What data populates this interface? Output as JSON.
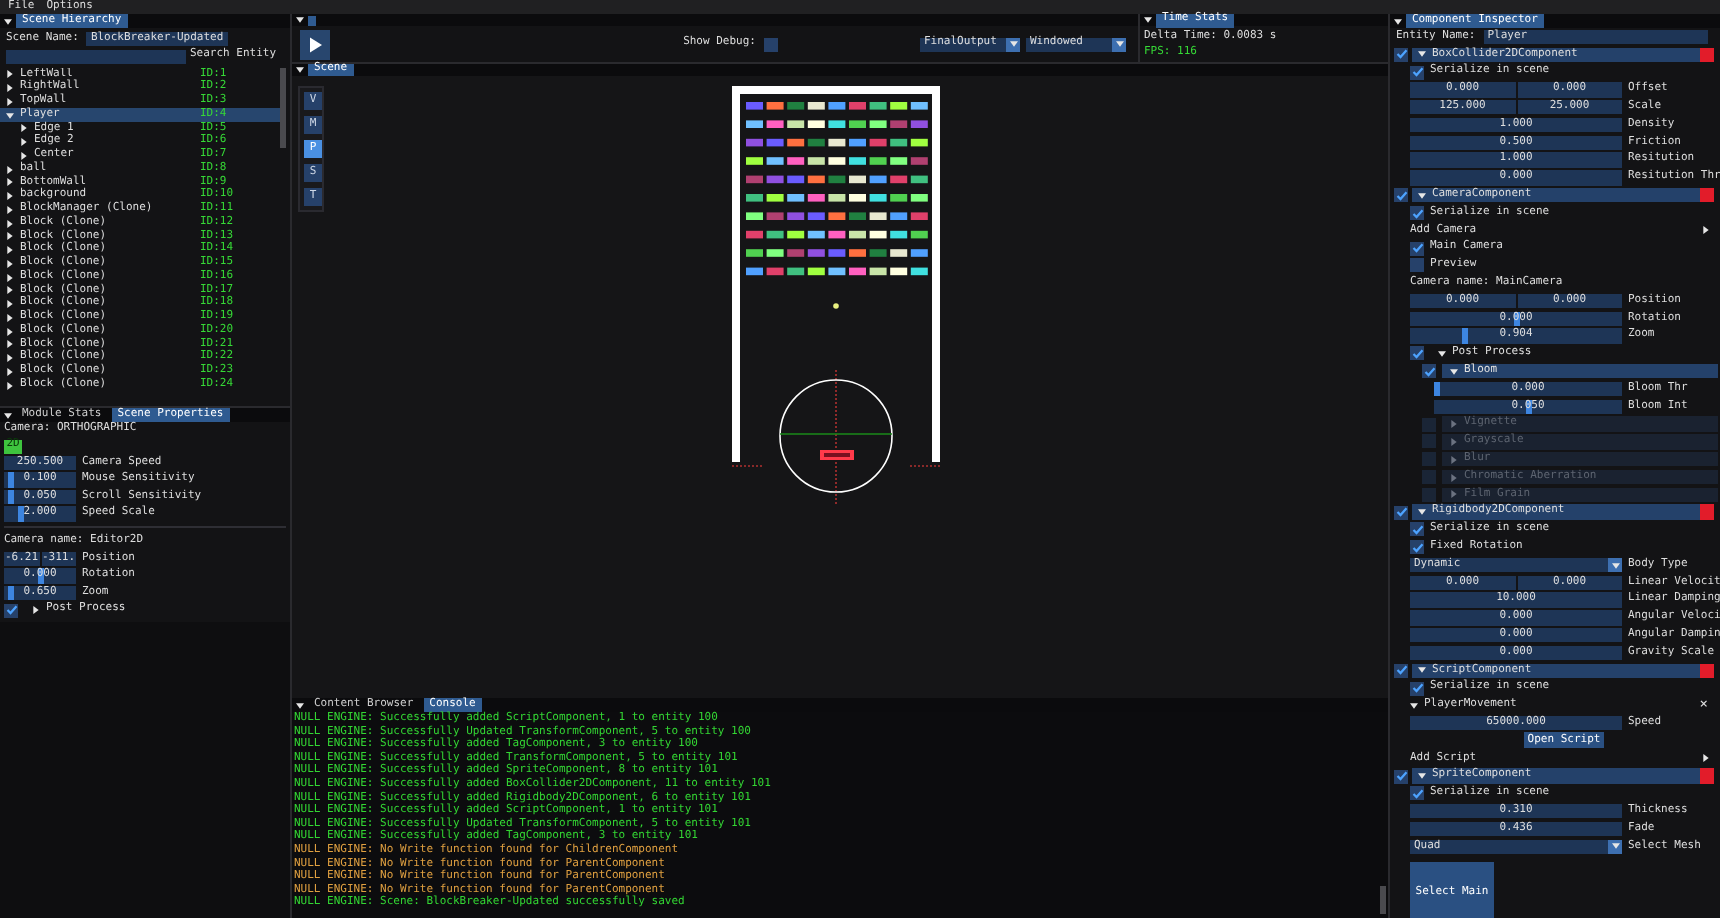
{
  "menu": [
    {
      "label": "File"
    },
    {
      "label": "Options"
    }
  ],
  "hierarchy": {
    "tab": "Scene Hierarchy",
    "scene_name_label": "Scene Name:",
    "scene_name": "BlockBreaker-Updated",
    "search_button": "Search Entity",
    "entities": [
      {
        "name": "LeftWall",
        "id": "ID:1",
        "selected": false,
        "expanded": false
      },
      {
        "name": "RightWall",
        "id": "ID:2",
        "selected": false,
        "expanded": false
      },
      {
        "name": "TopWall",
        "id": "ID:3",
        "selected": false,
        "expanded": false
      },
      {
        "name": "Player",
        "id": "ID:4",
        "selected": true,
        "expanded": true,
        "children": [
          {
            "name": "Edge 1",
            "id": "ID:5",
            "selected": false,
            "expanded": false
          },
          {
            "name": "Edge 2",
            "id": "ID:6",
            "selected": false,
            "expanded": false
          },
          {
            "name": "Center",
            "id": "ID:7",
            "selected": false,
            "expanded": false
          }
        ]
      },
      {
        "name": "ball",
        "id": "ID:8",
        "selected": false,
        "expanded": false
      },
      {
        "name": "BottomWall",
        "id": "ID:9",
        "selected": false,
        "expanded": false
      },
      {
        "name": "background",
        "id": "ID:10",
        "selected": false,
        "expanded": false
      },
      {
        "name": "BlockManager (Clone)",
        "id": "ID:11",
        "selected": false,
        "expanded": false
      },
      {
        "name": "Block (Clone)",
        "id": "ID:12",
        "selected": false,
        "expanded": false
      },
      {
        "name": "Block (Clone)",
        "id": "ID:13",
        "selected": false,
        "expanded": false
      },
      {
        "name": "Block (Clone)",
        "id": "ID:14",
        "selected": false,
        "expanded": false
      },
      {
        "name": "Block (Clone)",
        "id": "ID:15",
        "selected": false,
        "expanded": false
      },
      {
        "name": "Block (Clone)",
        "id": "ID:16",
        "selected": false,
        "expanded": false
      },
      {
        "name": "Block (Clone)",
        "id": "ID:17",
        "selected": false,
        "expanded": false
      },
      {
        "name": "Block (Clone)",
        "id": "ID:18",
        "selected": false,
        "expanded": false
      },
      {
        "name": "Block (Clone)",
        "id": "ID:19",
        "selected": false,
        "expanded": false
      },
      {
        "name": "Block (Clone)",
        "id": "ID:20",
        "selected": false,
        "expanded": false
      },
      {
        "name": "Block (Clone)",
        "id": "ID:21",
        "selected": false,
        "expanded": false
      },
      {
        "name": "Block (Clone)",
        "id": "ID:22",
        "selected": false,
        "expanded": false
      },
      {
        "name": "Block (Clone)",
        "id": "ID:23",
        "selected": false,
        "expanded": false
      },
      {
        "name": "Block (Clone)",
        "id": "ID:24",
        "selected": false,
        "expanded": false
      }
    ]
  },
  "properties": {
    "tabs": [
      {
        "label": "Module Stats",
        "selected": false
      },
      {
        "label": "Scene Properties",
        "selected": true
      }
    ],
    "camera_type": "Camera: ORTHOGRAPHIC",
    "mode_button": "2D",
    "rows": [
      {
        "kind": "fields",
        "values": [
          "250.500"
        ],
        "label": "Camera Speed"
      },
      {
        "kind": "slider",
        "value": "0.100",
        "level": 0.05,
        "label": "Mouse Sensitivity"
      },
      {
        "kind": "slider",
        "value": "0.050",
        "level": 0.05,
        "label": "Scroll Sensitivity"
      },
      {
        "kind": "slider",
        "value": "2.000",
        "level": 0.2,
        "label": "Speed Scale"
      }
    ],
    "camera_rows": [
      {
        "kind": "text",
        "text": "Camera name: Editor2D"
      },
      {
        "kind": "fields",
        "values": [
          "-6.21",
          "-311."
        ],
        "label": "Position"
      },
      {
        "kind": "slider",
        "value": "0.000",
        "level": 0.5,
        "label": "Rotation"
      },
      {
        "kind": "slider",
        "value": "0.650",
        "level": 0.05,
        "label": "Zoom"
      },
      {
        "kind": "node",
        "checked": true,
        "title": "Post Process",
        "expanded": false,
        "framed": false,
        "disabled": false
      }
    ]
  },
  "toolbar": {
    "show_debug_label": "Show Debug:",
    "show_debug": false,
    "dropdowns": [
      {
        "value": "FinalOutput"
      },
      {
        "value": "Windowed"
      }
    ]
  },
  "time_stats": {
    "tab": "Time Stats",
    "delta": "Delta Time: 0.0083 s",
    "fps": "FPS: 116"
  },
  "scene": {
    "tab": "Scene",
    "gizmos": [
      {
        "label": "V",
        "selected": false
      },
      {
        "label": "M",
        "selected": false
      },
      {
        "label": "P",
        "selected": true
      },
      {
        "label": "S",
        "selected": false
      },
      {
        "label": "T",
        "selected": false
      }
    ]
  },
  "console": {
    "tabs": [
      {
        "label": "Content Browser",
        "selected": false
      },
      {
        "label": "Console",
        "selected": true
      }
    ],
    "lines": [
      {
        "text": "NULL ENGINE: Successfully added ScriptComponent, 1 to entity 100",
        "color": "#33d633"
      },
      {
        "text": "NULL ENGINE: Successfully Updated TransformComponent, 5 to entity 100",
        "color": "#33d633"
      },
      {
        "text": "NULL ENGINE: Successfully added TagComponent, 3 to entity 100",
        "color": "#33d633"
      },
      {
        "text": "NULL ENGINE: Successfully added TransformComponent, 5 to entity 101",
        "color": "#33d633"
      },
      {
        "text": "NULL ENGINE: Successfully added SpriteComponent, 8 to entity 101",
        "color": "#33d633"
      },
      {
        "text": "NULL ENGINE: Successfully added BoxCollider2DComponent, 11 to entity 101",
        "color": "#33d633"
      },
      {
        "text": "NULL ENGINE: Successfully added Rigidbody2DComponent, 6 to entity 101",
        "color": "#33d633"
      },
      {
        "text": "NULL ENGINE: Successfully added ScriptComponent, 1 to entity 101",
        "color": "#33d633"
      },
      {
        "text": "NULL ENGINE: Successfully Updated TransformComponent, 5 to entity 101",
        "color": "#33d633"
      },
      {
        "text": "NULL ENGINE: Successfully added TagComponent, 3 to entity 101",
        "color": "#33d633"
      },
      {
        "text": "NULL ENGINE: No Write function found for ChildrenComponent",
        "color": "#e0a040"
      },
      {
        "text": "NULL ENGINE: No Write function found for ParentComponent",
        "color": "#e0a040"
      },
      {
        "text": "NULL ENGINE: No Write function found for ParentComponent",
        "color": "#e0a040"
      },
      {
        "text": "NULL ENGINE: No Write function found for ParentComponent",
        "color": "#e0a040"
      },
      {
        "text": "NULL ENGINE: Scene: BlockBreaker-Updated successfully saved",
        "color": "#33d633"
      }
    ]
  },
  "inspector": {
    "tab": "Component Inspector",
    "entity_label": "Entity Name:",
    "entity_name": "Player",
    "components": [
      {
        "name": "BoxCollider2DComponent",
        "enabled": true,
        "rows": [
          {
            "kind": "checkbox",
            "checked": true,
            "text": "Serialize in scene"
          },
          {
            "kind": "fields",
            "values": [
              "0.000",
              "0.000"
            ],
            "label": "Offset"
          },
          {
            "kind": "fields",
            "values": [
              "125.000",
              "25.000"
            ],
            "label": "Scale"
          },
          {
            "kind": "fields",
            "values": [
              "1.000"
            ],
            "label": "Density"
          },
          {
            "kind": "fields",
            "values": [
              "0.500"
            ],
            "label": "Friction"
          },
          {
            "kind": "fields",
            "values": [
              "1.000"
            ],
            "label": "Resitution"
          },
          {
            "kind": "fields",
            "values": [
              "0.000"
            ],
            "label": "Resitution Thr"
          }
        ]
      },
      {
        "name": "CameraComponent",
        "enabled": true,
        "rows": [
          {
            "kind": "checkbox",
            "checked": true,
            "text": "Serialize in scene"
          },
          {
            "kind": "arrow",
            "label": "Add Camera"
          },
          {
            "kind": "checkbox",
            "checked": true,
            "text": "Main Camera"
          },
          {
            "kind": "checkbox",
            "checked": false,
            "text": "Preview"
          },
          {
            "kind": "text",
            "text": "Camera name: MainCamera"
          },
          {
            "kind": "fields",
            "values": [
              "0.000",
              "0.000"
            ],
            "label": "Position"
          },
          {
            "kind": "slider",
            "value": "0.000",
            "level": 0.5,
            "label": "Rotation"
          },
          {
            "kind": "slider",
            "value": "0.904",
            "level": 0.25,
            "label": "Zoom"
          },
          {
            "kind": "node",
            "checked": true,
            "title": "Post Process",
            "expanded": true,
            "framed": false,
            "disabled": false,
            "children": [
              {
                "kind": "node",
                "checked": true,
                "title": "Bloom",
                "expanded": true,
                "framed": true,
                "disabled": false,
                "children": [
                  {
                    "kind": "slider",
                    "value": "0.000",
                    "level": 0.0,
                    "label": "Bloom Thr"
                  },
                  {
                    "kind": "slider",
                    "value": "0.050",
                    "level": 0.5,
                    "label": "Bloom Int"
                  }
                ]
              },
              {
                "kind": "node",
                "checked": false,
                "title": "Vignette",
                "expanded": false,
                "framed": true,
                "disabled": true
              },
              {
                "kind": "node",
                "checked": false,
                "title": "Grayscale",
                "expanded": false,
                "framed": true,
                "disabled": true
              },
              {
                "kind": "node",
                "checked": false,
                "title": "Blur",
                "expanded": false,
                "framed": true,
                "disabled": true
              },
              {
                "kind": "node",
                "checked": false,
                "title": "Chromatic Aberration",
                "expanded": false,
                "framed": true,
                "disabled": true
              },
              {
                "kind": "node",
                "checked": false,
                "title": "Film Grain",
                "expanded": false,
                "framed": true,
                "disabled": true
              }
            ]
          }
        ]
      },
      {
        "name": "Rigidbody2DComponent",
        "enabled": true,
        "rows": [
          {
            "kind": "checkbox",
            "checked": true,
            "text": "Serialize in scene"
          },
          {
            "kind": "checkbox",
            "checked": true,
            "text": "Fixed Rotation"
          },
          {
            "kind": "dropdown",
            "value": "Dynamic",
            "label": "Body Type"
          },
          {
            "kind": "fields",
            "values": [
              "0.000",
              "0.000"
            ],
            "label": "Linear Velocit"
          },
          {
            "kind": "fields",
            "values": [
              "10.000"
            ],
            "label": "Linear Damping"
          },
          {
            "kind": "fields",
            "values": [
              "0.000"
            ],
            "label": "Angular Veloci"
          },
          {
            "kind": "fields",
            "values": [
              "0.000"
            ],
            "label": "Angular Dampin"
          },
          {
            "kind": "fields",
            "values": [
              "0.000"
            ],
            "label": "Gravity Scale"
          }
        ]
      },
      {
        "name": "ScriptComponent",
        "enabled": true,
        "rows": [
          {
            "kind": "checkbox",
            "checked": true,
            "text": "Serialize in scene"
          },
          {
            "kind": "script",
            "label": "PlayerMovement",
            "close": "×"
          },
          {
            "kind": "fields",
            "values": [
              "65000.000"
            ],
            "label": "Speed"
          },
          {
            "kind": "button",
            "label": "Open Script"
          },
          {
            "kind": "arrow",
            "label": "Add Script"
          }
        ]
      },
      {
        "name": "SpriteComponent",
        "enabled": true,
        "rows": [
          {
            "kind": "checkbox",
            "checked": true,
            "text": "Serialize in scene"
          },
          {
            "kind": "fields",
            "values": [
              "0.310"
            ],
            "label": "Thickness"
          },
          {
            "kind": "fields",
            "values": [
              "0.436"
            ],
            "label": "Fade"
          },
          {
            "kind": "dropdown",
            "value": "Quad",
            "label": "Select Mesh"
          },
          {
            "kind": "tile",
            "label": "Select Main"
          }
        ]
      }
    ]
  }
}
